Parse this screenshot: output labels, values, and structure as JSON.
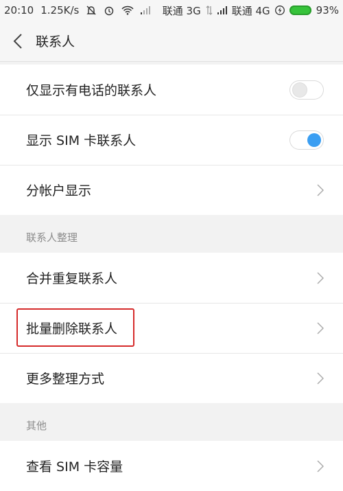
{
  "status_bar": {
    "time": "20:10",
    "speed": "1.25K/s",
    "carrier1": "联通 3G",
    "carrier2": "联通 4G",
    "battery_percent": "93%",
    "icons": [
      "mute-icon",
      "alarm-icon",
      "wifi-icon",
      "signal-icon",
      "data-icon",
      "signal-icon",
      "charging-icon",
      "battery-icon"
    ]
  },
  "header": {
    "title": "联系人",
    "back_icon": "chevron-left-icon"
  },
  "sections": {
    "display": {
      "items": [
        {
          "label": "仅显示有电话的联系人",
          "control": "toggle",
          "checked": false
        },
        {
          "label": "显示 SIM 卡联系人",
          "control": "toggle",
          "checked": true
        },
        {
          "label": "分帐户显示",
          "control": "chevron"
        }
      ]
    },
    "organize": {
      "header": "联系人整理",
      "items": [
        {
          "label": "合并重复联系人",
          "control": "chevron"
        },
        {
          "label": "批量删除联系人",
          "control": "chevron",
          "highlighted": true
        },
        {
          "label": "更多整理方式",
          "control": "chevron"
        }
      ]
    },
    "other": {
      "header": "其他",
      "items": [
        {
          "label": "查看 SIM 卡容量",
          "control": "chevron"
        }
      ]
    }
  },
  "colors": {
    "toggle_on": "#3a9ef2",
    "highlight": "#d52a2a",
    "battery": "#36c33a"
  }
}
